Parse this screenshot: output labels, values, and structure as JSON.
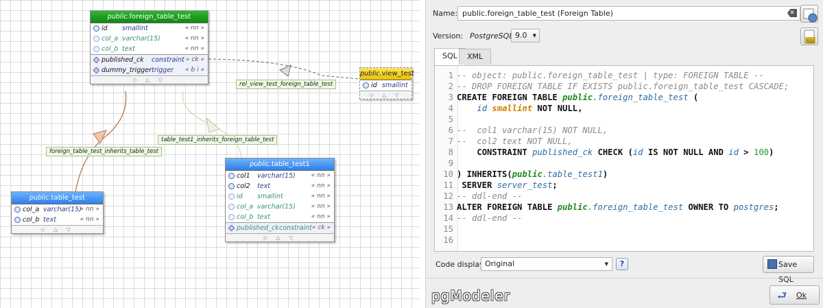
{
  "canvas": {
    "tables": {
      "foreign_table_test": {
        "schema": "public.",
        "name": "foreign_table_test",
        "columns": [
          {
            "name": "id",
            "type": "smallint",
            "constraint": "« nn »"
          },
          {
            "name": "col_a",
            "type": "varchar(15)",
            "constraint": "« nn »"
          },
          {
            "name": "col_b",
            "type": "text",
            "constraint": "« nn »"
          }
        ],
        "extras": [
          {
            "name": "published_ck",
            "type": "constraint",
            "constraint": "« ck »"
          },
          {
            "name": "dummy_trigger",
            "type": "trigger",
            "constraint": "« b i »"
          }
        ]
      },
      "view_test": {
        "schema": "public.",
        "name": "view_test",
        "columns": [
          {
            "name": "id",
            "type": "smallint"
          }
        ]
      },
      "table_test1": {
        "schema": "public.",
        "name": "table_test1",
        "columns": [
          {
            "name": "col1",
            "type": "varchar(15)",
            "constraint": "« nn »"
          },
          {
            "name": "col2",
            "type": "text",
            "constraint": "« nn »"
          },
          {
            "name": "id",
            "type": "smallint",
            "constraint": "« nn »"
          },
          {
            "name": "col_a",
            "type": "varchar(15)",
            "constraint": "« nn »"
          },
          {
            "name": "col_b",
            "type": "text",
            "constraint": "« nn »"
          }
        ],
        "extras": [
          {
            "name": "published_ck",
            "type": "constraint",
            "constraint": "« ck »"
          }
        ]
      },
      "table_test": {
        "schema": "public.",
        "name": "table_test",
        "columns": [
          {
            "name": "col_a",
            "type": "varchar(15)",
            "constraint": "« nn »"
          },
          {
            "name": "col_b",
            "type": "text",
            "constraint": "« nn »"
          }
        ]
      }
    },
    "footer_glyphs": "◇ △ ▽",
    "relationships": {
      "rel_view": "rel_view_test_foreign_table_test",
      "inherits_1": "table_test1_inherits_foreign_table_test",
      "inherits_2": "foreign_table_test_inherits_table_test"
    },
    "colors": {
      "green_header": "#0e8a12",
      "blue_header": "#2f7fe8",
      "yellow_header": "#e9c200"
    }
  },
  "form": {
    "name_label": "Name:",
    "name_value": "public.foreign_table_test (Foreign Table)",
    "version_label": "Version:",
    "version_dbms": "PostgreSQL",
    "version_value": "9.0",
    "tabs": [
      "SQL",
      "XML"
    ],
    "code_display_label": "Code display:",
    "code_display_value": "Original",
    "save_sql_label": "Save SQL",
    "ok_label": "Ok",
    "logo": "pgModeler"
  },
  "code_lines": [
    "1",
    "2",
    "3",
    "4",
    "5",
    "6",
    "7",
    "8",
    "9",
    "10",
    "11",
    "12",
    "13",
    "14",
    "15",
    "16"
  ],
  "code": {
    "l1": "-- object: public.foreign_table_test | type: FOREIGN TABLE --",
    "l2": "-- DROP FOREIGN TABLE IF EXISTS public.foreign_table_test CASCADE;",
    "l3": [
      "CREATE FOREIGN TABLE ",
      "public",
      ".foreign_table_test",
      " ("
    ],
    "l4": [
      "id",
      "smallint",
      " NOT NULL,"
    ],
    "l6": "--  col1 varchar(15) NOT NULL,",
    "l7": "--  col2 text NOT NULL,",
    "l8": [
      "CONSTRAINT ",
      "published_ck",
      " CHECK (",
      "id",
      " IS NOT NULL AND ",
      "id",
      " > ",
      "100",
      ")"
    ],
    "l10": [
      ") INHERITS(",
      "public",
      ".table_test1",
      ")"
    ],
    "l11": [
      " SERVER ",
      "server_test",
      ";"
    ],
    "l12": "-- ddl-end --",
    "l13": [
      "ALTER FOREIGN TABLE ",
      "public",
      ".foreign_table_test",
      " OWNER TO ",
      "postgres",
      ";"
    ],
    "l14": "-- ddl-end --"
  }
}
